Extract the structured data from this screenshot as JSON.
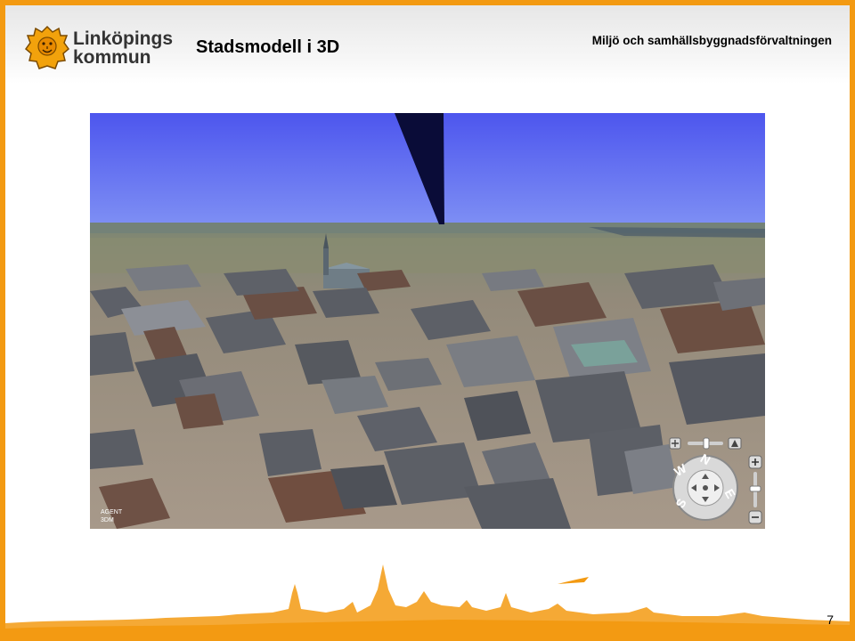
{
  "header": {
    "logo_line1": "Linköpings",
    "logo_line2": "kommun",
    "title": "Stadsmodell i 3D",
    "department": "Miljö och samhällsbyggnadsförvaltningen"
  },
  "map_view": {
    "watermark_line1": "AGENT",
    "watermark_line2": "3DM"
  },
  "navigation_controls": {
    "compass_letters": [
      "N",
      "E",
      "S",
      "W"
    ]
  },
  "footer": {
    "page_number": "7"
  },
  "colors": {
    "frame": "#f39a12",
    "sky": "#5a63f0",
    "roof_gray": "#5d6068",
    "roof_brown": "#6a4f44"
  }
}
